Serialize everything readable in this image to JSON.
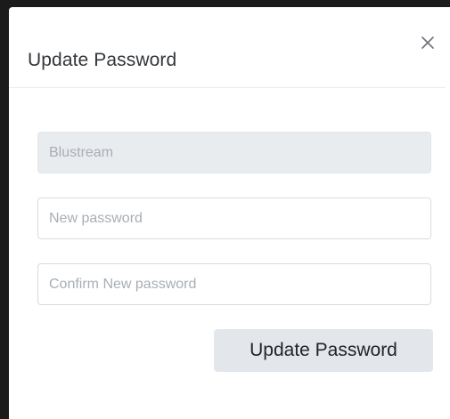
{
  "modal": {
    "title": "Update Password",
    "close_icon": "close-icon"
  },
  "form": {
    "username": {
      "value": "",
      "placeholder": "Blustream",
      "disabled": true
    },
    "new_password": {
      "value": "",
      "placeholder": "New password"
    },
    "confirm_password": {
      "value": "",
      "placeholder": "Confirm New password"
    },
    "submit_label": "Update Password"
  },
  "colors": {
    "button_bg": "#e3e6ea",
    "disabled_field_bg": "#e9ecef",
    "text": "#33373b"
  }
}
